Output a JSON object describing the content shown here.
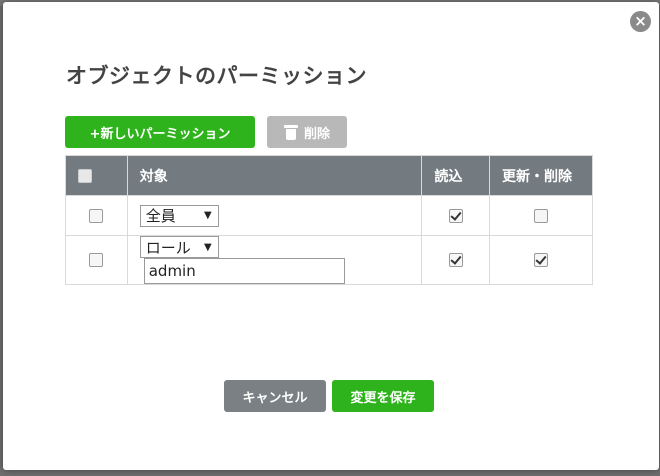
{
  "dialog": {
    "title": "オブジェクトのパーミッション",
    "close_glyph": "×"
  },
  "toolbar": {
    "add_label": "+新しいパーミッション",
    "delete_label": "削除"
  },
  "table": {
    "headers": {
      "target": "対象",
      "read": "読込",
      "update_delete": "更新・削除"
    },
    "rows": [
      {
        "selected": false,
        "target_type": "全員",
        "value": "",
        "read": true,
        "update_delete": false
      },
      {
        "selected": false,
        "target_type": "ロール",
        "value": "admin",
        "read": true,
        "update_delete": true
      }
    ]
  },
  "footer": {
    "cancel_label": "キャンセル",
    "save_label": "変更を保存"
  },
  "colors": {
    "primary_green": "#2fb31c",
    "header_gray": "#737b80",
    "disabled_gray": "#b8b8b8"
  }
}
